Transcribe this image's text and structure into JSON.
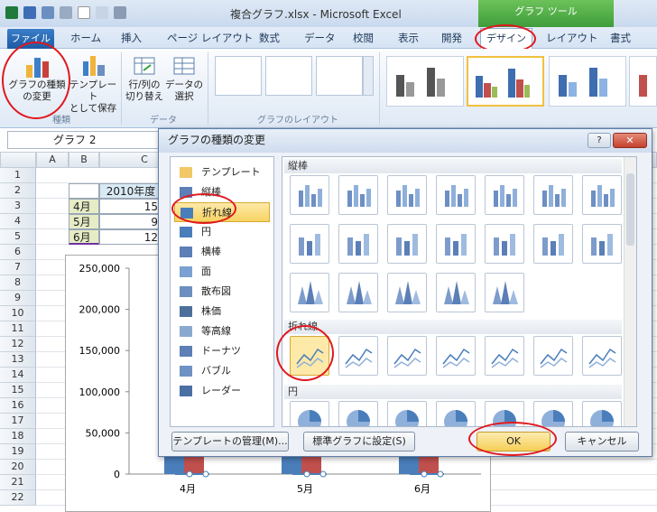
{
  "window": {
    "title": "複合グラフ.xlsx - Microsoft Excel",
    "context_tab_group": "グラフ ツール"
  },
  "ribbon_tabs": [
    "ファイル",
    "ホーム",
    "挿入",
    "ページ レイアウト",
    "数式",
    "データ",
    "校閲",
    "表示",
    "開発",
    "デザイン",
    "レイアウト",
    "書式"
  ],
  "ribbon": {
    "change_type_label": "グラフの種類\nの変更",
    "save_template_label": "テンプレート\nとして保存",
    "switch_rowcol_label": "行/列の\n切り替え",
    "select_data_label": "データの\n選択",
    "group_type": "種類",
    "group_data": "データ",
    "group_layout": "グラフのレイアウト"
  },
  "namebox": {
    "value": "グラフ 2"
  },
  "sheet": {
    "columns": [
      "A",
      "B",
      "C"
    ],
    "rows": [
      "1",
      "2",
      "3",
      "4",
      "5",
      "6",
      "7",
      "8",
      "9",
      "10",
      "11",
      "12",
      "13",
      "14",
      "15",
      "16",
      "17",
      "18",
      "19",
      "20",
      "21",
      "22"
    ],
    "cells": {
      "c2": "2010年度",
      "b3": "4月",
      "c3": "15",
      "b4": "5月",
      "c4": "9",
      "b5": "6月",
      "c5": "12"
    }
  },
  "chart_data": {
    "type": "bar",
    "categories": [
      "4月",
      "5月",
      "6月"
    ],
    "y_ticks": [
      "250,000",
      "200,000",
      "150,000",
      "100,000",
      "50,000",
      "0"
    ],
    "ylim": [
      0,
      250000
    ],
    "series": [
      {
        "values": [
          150000,
          90000,
          120000
        ],
        "color": "#4a7ebb"
      },
      {
        "values": [
          28000,
          28000,
          28000
        ],
        "color": "#c0504d"
      },
      {
        "values": [
          0,
          0,
          0
        ],
        "type": "line",
        "color": "#4a7ebb"
      }
    ]
  },
  "dialog": {
    "title": "グラフの種類の変更",
    "help": "?",
    "close": "✕",
    "categories": [
      "テンプレート",
      "縦棒",
      "折れ線",
      "円",
      "横棒",
      "面",
      "散布図",
      "株価",
      "等高線",
      "ドーナツ",
      "バブル",
      "レーダー"
    ],
    "selected_category": "折れ線",
    "section_column": "縦棒",
    "section_line": "折れ線",
    "section_pie": "円",
    "btn_manage": "テンプレートの管理(M)...",
    "btn_default": "標準グラフに設定(S)",
    "btn_ok": "OK",
    "btn_cancel": "キャンセル"
  },
  "colors": {
    "accent_blue": "#4a7ebb",
    "accent_red": "#c0504d",
    "annotation_red": "#e0181e",
    "ok_highlight": "#f9d779"
  }
}
